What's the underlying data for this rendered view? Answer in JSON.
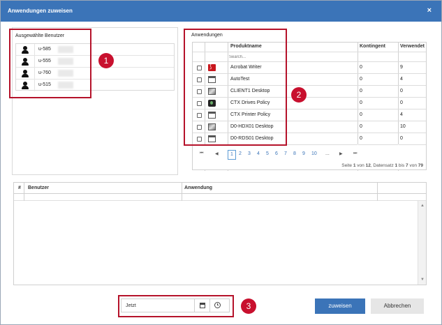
{
  "dialog": {
    "title": "Anwendungen zuweisen",
    "close_glyph": "×"
  },
  "users_panel": {
    "title": "Ausgewählte Benutzer",
    "users": [
      {
        "name": "u-585"
      },
      {
        "name": "u-555"
      },
      {
        "name": "u-760"
      },
      {
        "name": "u-515"
      }
    ]
  },
  "apps_panel": {
    "title": "Anwendungen",
    "columns": {
      "product": "Produktname",
      "kontingent": "Kontingent",
      "verwendet": "Verwendet"
    },
    "search_placeholder": "Search...",
    "rows": [
      {
        "name": "Acrobat Writer",
        "kontingent": "0",
        "verwendet": "9",
        "icon": "pdf-icon"
      },
      {
        "name": "AutoTest",
        "kontingent": "0",
        "verwendet": "4",
        "icon": "window-icon"
      },
      {
        "name": "CLIENT1 Desktop",
        "kontingent": "0",
        "verwendet": "0",
        "icon": "desktop-icon"
      },
      {
        "name": "CTX Drives Policy",
        "kontingent": "0",
        "verwendet": "0",
        "icon": "policy-icon"
      },
      {
        "name": "CTX Printer Policy",
        "kontingent": "0",
        "verwendet": "4",
        "icon": "window-icon"
      },
      {
        "name": "D0-HDX01 Desktop",
        "kontingent": "0",
        "verwendet": "10",
        "icon": "desktop-icon"
      },
      {
        "name": "D0-RDS01 Desktop",
        "kontingent": "0",
        "verwendet": "0",
        "icon": "window-icon"
      }
    ],
    "pager": {
      "first": "⏮",
      "prev": "◀",
      "pages": [
        "1",
        "2",
        "3",
        "4",
        "5",
        "6",
        "7",
        "8",
        "9",
        "10"
      ],
      "active_page": "1",
      "ellipsis": "...",
      "next": "▶",
      "last": "⏭"
    },
    "page_info": {
      "text1": "Seite ",
      "page": "1",
      "text2": " von ",
      "pages": "12",
      "text3": ", Datensatz ",
      "from": "1",
      "text4": " bis ",
      "to": "7",
      "text5": " von ",
      "total": "79"
    }
  },
  "assignments_grid": {
    "columns": {
      "num": "#",
      "user": "Benutzer",
      "app": "Anwendung"
    }
  },
  "footer": {
    "datetime_value": "Jetzt",
    "assign_label": "zuweisen",
    "cancel_label": "Abbrechen"
  },
  "callouts": [
    "1",
    "2",
    "3"
  ],
  "colors": {
    "accent": "#3b74b8",
    "callout": "#c8102e"
  }
}
